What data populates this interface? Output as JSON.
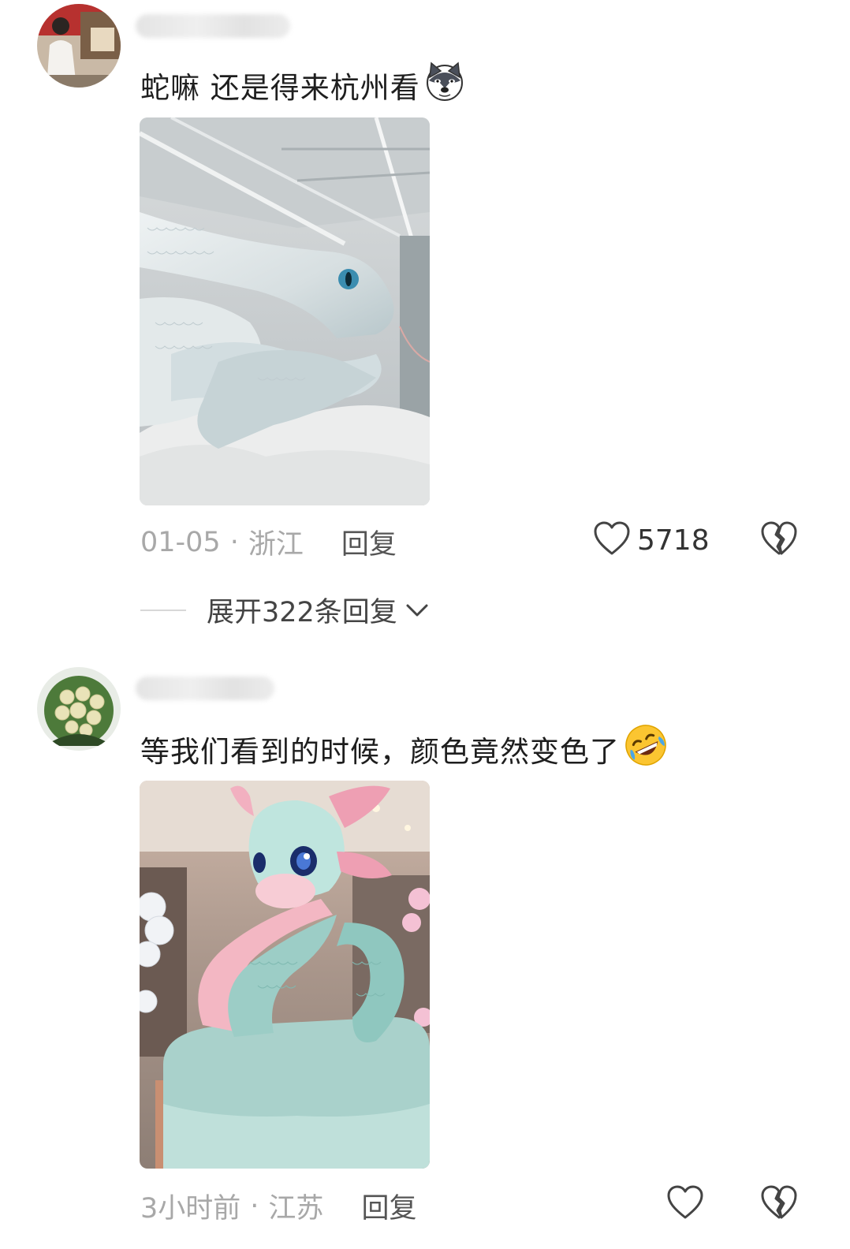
{
  "comments": [
    {
      "text": "蛇嘛 还是得来杭州看",
      "emoji_icon": "husky-dog-emoji-icon",
      "date": "01-05",
      "separator": "·",
      "location": "浙江",
      "reply_label": "回复",
      "likes": "5718",
      "photo": "white-snake-sculpture"
    },
    {
      "text": "等我们看到的时候，颜色竟然变色了",
      "emoji_icon": "rolling-laughing-emoji-icon",
      "date": "3小时前",
      "separator": "·",
      "location": "江苏",
      "reply_label": "回复",
      "likes": "",
      "photo": "pink-blue-snake-sculpture"
    }
  ],
  "expand_replies": {
    "label": "展开322条回复",
    "icon": "chevron-down-icon"
  },
  "colors": {
    "meta_gray": "#a8a8a8",
    "reply_dark": "#555555",
    "text": "#1e1e1e"
  }
}
